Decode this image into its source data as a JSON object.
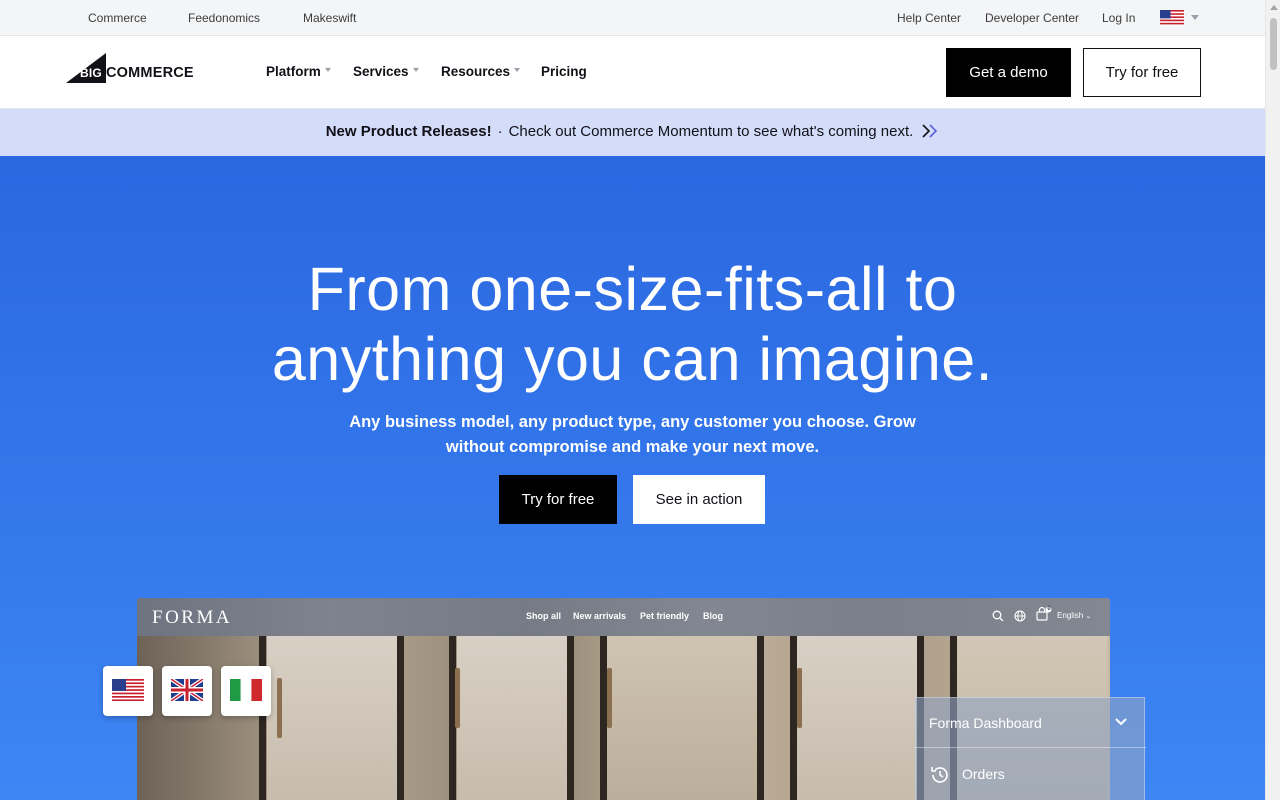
{
  "utility_bar": {
    "left_links": [
      "Commerce",
      "Feedonomics",
      "Makeswift"
    ],
    "right_links": [
      "Help Center",
      "Developer Center",
      "Log In"
    ],
    "region_flag_icon": "us-flag-icon"
  },
  "nav": {
    "logo_big": "BIG",
    "logo_commerce": "COMMERCE",
    "items": [
      {
        "label": "Platform",
        "has_dropdown": true
      },
      {
        "label": "Services",
        "has_dropdown": true
      },
      {
        "label": "Resources",
        "has_dropdown": true
      },
      {
        "label": "Pricing",
        "has_dropdown": false
      }
    ],
    "demo_label": "Get a demo",
    "try_label": "Try for free"
  },
  "announcement": {
    "strong": "New Product Releases!",
    "separator": "·",
    "text": "Check out Commerce Momentum to see what's coming next.",
    "arrow_icon": "double-chevron-right-icon"
  },
  "hero": {
    "title_line1": "From one-size-fits-all to",
    "title_line2": "anything you can imagine.",
    "subtitle": "Any business model, any product type, any customer you choose. Grow without compromise and make your next move.",
    "try_label": "Try for free",
    "see_label": "See in action"
  },
  "mockup": {
    "brand": "FORMA",
    "links": [
      "Shop all",
      "New arrivals",
      "Pet friendly",
      "Blog"
    ],
    "cart_count": "0",
    "language": "English"
  },
  "language_flags": [
    "us-flag-icon",
    "uk-flag-icon",
    "italy-flag-icon"
  ],
  "dashboard": {
    "title": "Forma Dashboard",
    "items": [
      {
        "label": "Orders",
        "icon": "history-icon"
      }
    ]
  },
  "colors": {
    "hero_top": "#2b67e0",
    "hero_bottom": "#3d86f4",
    "announce_bg": "#d3dcf9",
    "primary_button": "#000000"
  }
}
